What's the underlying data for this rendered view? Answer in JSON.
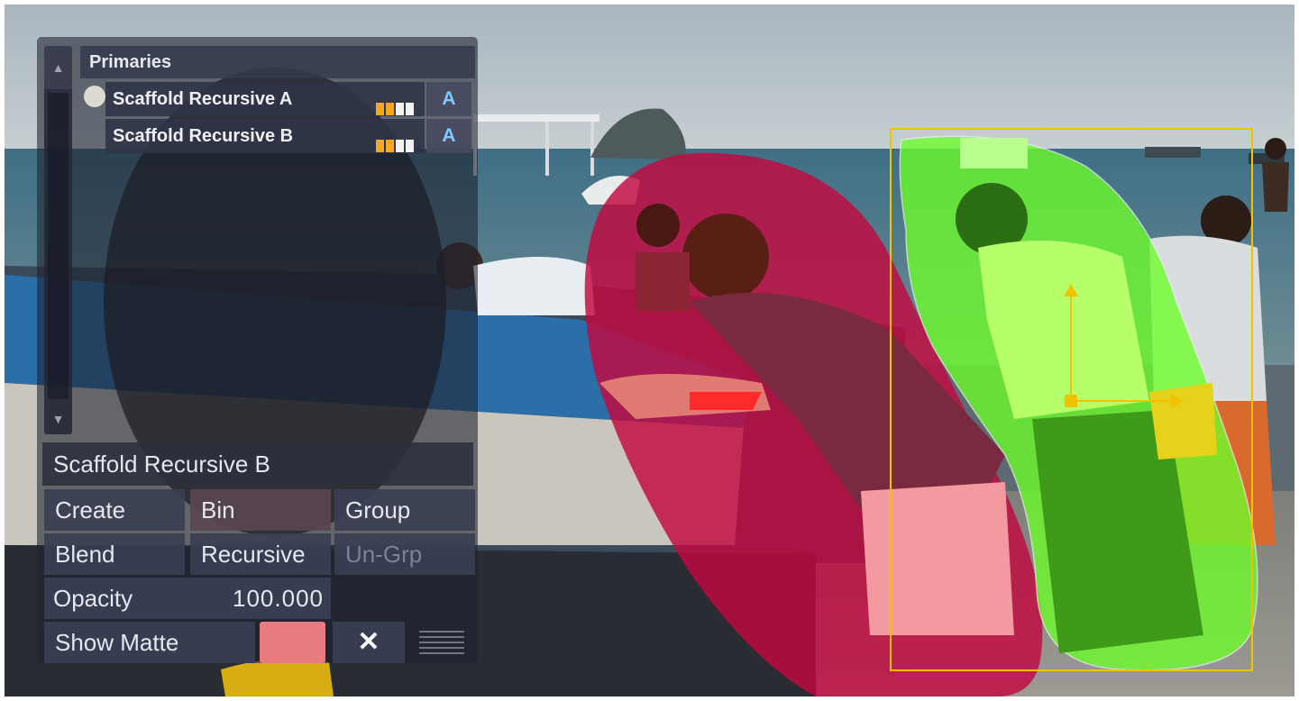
{
  "panel": {
    "header": "Primaries",
    "scroll_up_icon": "▲",
    "scroll_down_icon": "▼",
    "layers": [
      {
        "name": "Scaffold Recursive A",
        "badge": "A",
        "selected": true
      },
      {
        "name": "Scaffold Recursive B",
        "badge": "A",
        "selected": false
      }
    ],
    "current_layer": "Scaffold Recursive B",
    "buttons": {
      "create": "Create",
      "bin": "Bin",
      "group": "Group",
      "blend": "Blend",
      "recursive": "Recursive",
      "ungroup": "Un-Grp",
      "show_matte": "Show Matte",
      "clear": "✕"
    },
    "opacity": {
      "label": "Opacity",
      "value": "100.000"
    },
    "matte_color": "#e87a82"
  },
  "colors": {
    "mask_red": "#c2093f",
    "mask_green": "#6dff2a",
    "bbox_yellow": "#f2c200"
  }
}
